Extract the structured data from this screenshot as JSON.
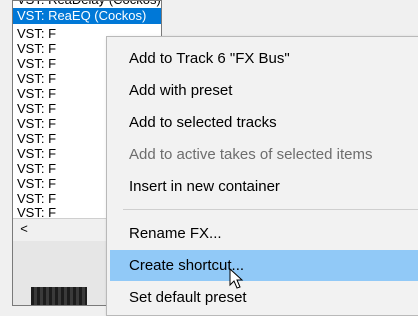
{
  "fx_list": {
    "top_cut_text": "VST: ReaDelay (Cockos)",
    "selected_text": "VST: ReaEQ (Cockos)",
    "rows": [
      "VST: F",
      "VST: F",
      "VST: F",
      "VST: F",
      "VST: F",
      "VST: F",
      "VST: F",
      "VST: F",
      "VST: F",
      "VST: F",
      "VST: F",
      "VST: F",
      "VST: F"
    ],
    "scroll_left_icon": "<"
  },
  "menu": {
    "items": [
      {
        "label": "Add to Track 6 \"FX Bus\"",
        "disabled": false
      },
      {
        "label": "Add with preset",
        "disabled": false
      },
      {
        "label": "Add to selected tracks",
        "disabled": false
      },
      {
        "label": "Add to active takes of selected items",
        "disabled": true
      },
      {
        "label": "Insert in new container",
        "disabled": false
      },
      {
        "label": "Rename FX...",
        "disabled": false
      },
      {
        "label": "Create shortcut...",
        "disabled": false,
        "highlighted": true
      },
      {
        "label": "Set default preset",
        "disabled": false
      }
    ]
  },
  "colors": {
    "selection": "#0078d7",
    "menu_highlight": "#91c9f7",
    "disabled_text": "#6d6d6d"
  }
}
